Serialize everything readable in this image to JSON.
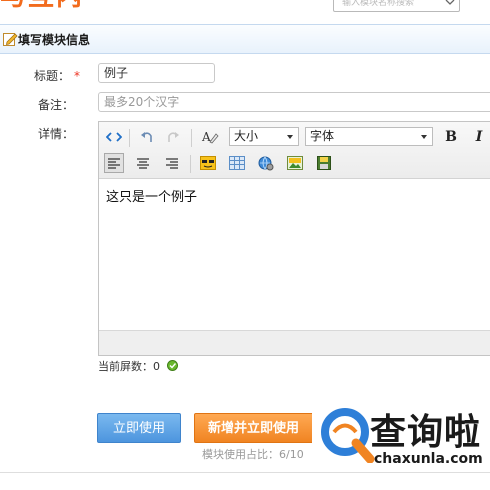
{
  "header": {
    "logo_text": "与互内",
    "search_placeholder": "输入模块名称搜索"
  },
  "section": {
    "title": "填写模块信息"
  },
  "form": {
    "title_label": "标题：",
    "required_mark": "*",
    "title_value": "例子",
    "note_label": "备注：",
    "note_placeholder": "最多20个汉字",
    "detail_label": "详情："
  },
  "editor": {
    "size_dropdown": "大小",
    "font_dropdown": "字体",
    "bold_label": "B",
    "italic_label": "I",
    "content": "这只是一个例子"
  },
  "screen_count": "当前屏数：0",
  "buttons": {
    "use_now": "立即使用",
    "add_and_use": "新增并立即使用"
  },
  "usage_text": "模块使用占比：6/10",
  "watermark": {
    "brand_cn": "查询啦",
    "brand_url": "chaxunla.com"
  },
  "colors": {
    "orange": "#f08422",
    "blue": "#4d95de",
    "accent_green": "#6ab82e"
  }
}
